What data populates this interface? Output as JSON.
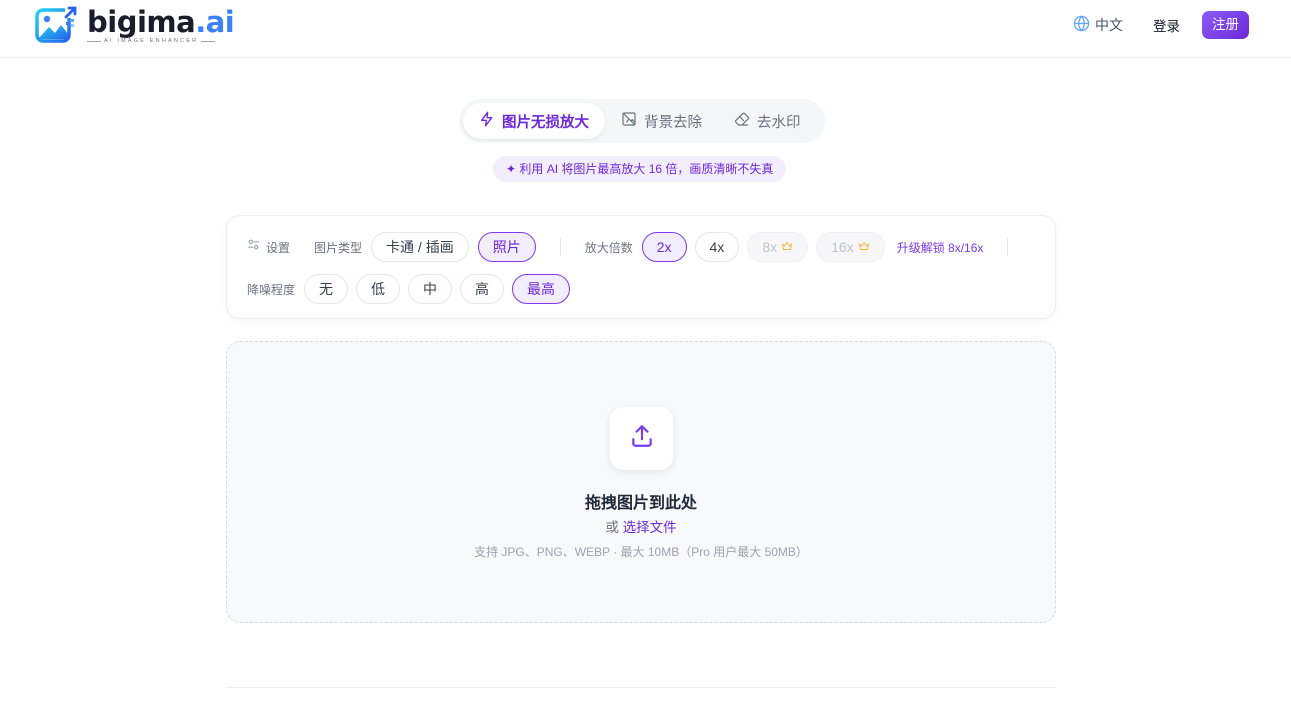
{
  "header": {
    "logo": {
      "name": "bigima",
      "dot": ".",
      "suffix": "ai",
      "tagline": "AI IMAGE ENHANCER"
    },
    "lang_label": "中文",
    "login_label": "登录",
    "signup_label": "注册"
  },
  "tabs": [
    {
      "label": "图片无损放大",
      "icon": "zap-icon",
      "active": true
    },
    {
      "label": "背景去除",
      "icon": "image-off-icon",
      "active": false
    },
    {
      "label": "去水印",
      "icon": "eraser-icon",
      "active": false
    }
  ],
  "tagline": "✦ 利用 AI 将图片最高放大 16 倍，画质清晰不失真",
  "settings": {
    "label": "设置",
    "image_type_label": "图片类型",
    "image_types": [
      "卡通 / 插画",
      "照片"
    ],
    "scale_label": "放大倍数",
    "scales": [
      "2x",
      "4x",
      "8x",
      "16x"
    ],
    "upgrade_label": "升级解锁 8x/16x",
    "denoise_label": "降噪程度",
    "denoise_levels": [
      "无",
      "低",
      "中",
      "高",
      "最高"
    ]
  },
  "dropzone": {
    "title": "拖拽图片到此处",
    "or_label": "或",
    "pick_label": "选择文件",
    "note": "支持 JPG、PNG、WEBP · 最大 10MB（Pro 用户最大 50MB）"
  },
  "colors": {
    "accent": "#6d28d9",
    "accent_light": "#f3eefe",
    "brand_blue": "#3b82f6",
    "crown": "#f5b942"
  }
}
